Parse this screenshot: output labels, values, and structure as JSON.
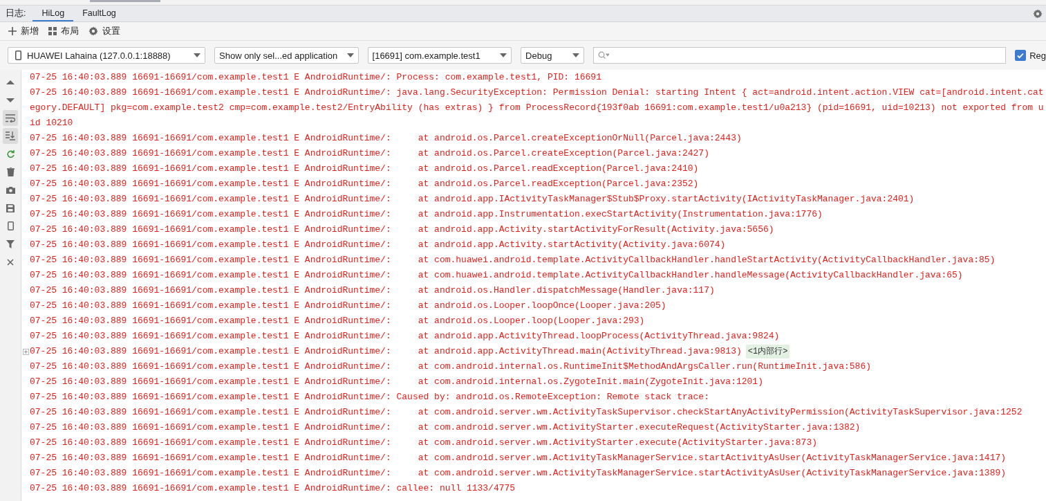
{
  "tabs_label": "日志:",
  "tabs": [
    {
      "label": "HiLog",
      "selected": true
    },
    {
      "label": "FaultLog",
      "selected": false
    }
  ],
  "toolbar": [
    {
      "kind": "add",
      "label": "新增"
    },
    {
      "kind": "layout",
      "label": "布局"
    },
    {
      "kind": "settings",
      "label": "设置"
    }
  ],
  "filters": {
    "device": {
      "kind": "device",
      "value": "HUAWEI Lahaina (127.0.0.1:18888)"
    },
    "dropdowns": [
      {
        "value": "Show only sel...ed application"
      },
      {
        "value": "[16691] com.example.test1"
      },
      {
        "value": "Debug"
      }
    ],
    "regex": {
      "label": "Reg",
      "checked": true
    }
  },
  "side_tools": [
    {
      "kind": "up",
      "selected": false
    },
    {
      "kind": "down",
      "selected": false
    },
    {
      "kind": "wrap",
      "selected": true
    },
    {
      "kind": "scroll-end",
      "selected": true
    },
    {
      "kind": "restart",
      "selected": false
    },
    {
      "kind": "delete",
      "selected": false
    },
    {
      "kind": "camera",
      "selected": false
    },
    {
      "kind": "save",
      "selected": false
    },
    {
      "kind": "device",
      "selected": false
    },
    {
      "kind": "filter",
      "selected": false
    },
    {
      "kind": "close",
      "selected": false
    }
  ],
  "log": [
    {
      "kind": "error",
      "text": "07-25 16:40:03.889 16691-16691/com.example.test1 E AndroidRuntime/: Process: com.example.test1, PID: 16691"
    },
    {
      "kind": "error",
      "text": "07-25 16:40:03.889 16691-16691/com.example.test1 E AndroidRuntime/: java.lang.SecurityException: Permission Denial: starting Intent { act=android.intent.action.VIEW cat=[android.intent.category.DEFAULT] pkg=com.example.test2 cmp=com.example.test2/EntryAbility (has extras) } from ProcessRecord{193f0ab 16691:com.example.test1/u0a213} (pid=16691, uid=10213) not exported from uid 10210"
    },
    {
      "kind": "error",
      "text": "07-25 16:40:03.889 16691-16691/com.example.test1 E AndroidRuntime/:     at android.os.Parcel.createExceptionOrNull(Parcel.java:2443)"
    },
    {
      "kind": "error",
      "text": "07-25 16:40:03.889 16691-16691/com.example.test1 E AndroidRuntime/:     at android.os.Parcel.createException(Parcel.java:2427)"
    },
    {
      "kind": "error",
      "text": "07-25 16:40:03.889 16691-16691/com.example.test1 E AndroidRuntime/:     at android.os.Parcel.readException(Parcel.java:2410)"
    },
    {
      "kind": "error",
      "text": "07-25 16:40:03.889 16691-16691/com.example.test1 E AndroidRuntime/:     at android.os.Parcel.readException(Parcel.java:2352)"
    },
    {
      "kind": "error",
      "text": "07-25 16:40:03.889 16691-16691/com.example.test1 E AndroidRuntime/:     at android.app.IActivityTaskManager$Stub$Proxy.startActivity(IActivityTaskManager.java:2401)"
    },
    {
      "kind": "error",
      "text": "07-25 16:40:03.889 16691-16691/com.example.test1 E AndroidRuntime/:     at android.app.Instrumentation.execStartActivity(Instrumentation.java:1776)"
    },
    {
      "kind": "error",
      "text": "07-25 16:40:03.889 16691-16691/com.example.test1 E AndroidRuntime/:     at android.app.Activity.startActivityForResult(Activity.java:5656)"
    },
    {
      "kind": "error",
      "text": "07-25 16:40:03.889 16691-16691/com.example.test1 E AndroidRuntime/:     at android.app.Activity.startActivity(Activity.java:6074)"
    },
    {
      "kind": "error",
      "text": "07-25 16:40:03.889 16691-16691/com.example.test1 E AndroidRuntime/:     at com.huawei.android.template.ActivityCallbackHandler.handleStartActivity(ActivityCallbackHandler.java:85)"
    },
    {
      "kind": "error",
      "text": "07-25 16:40:03.889 16691-16691/com.example.test1 E AndroidRuntime/:     at com.huawei.android.template.ActivityCallbackHandler.handleMessage(ActivityCallbackHandler.java:65)"
    },
    {
      "kind": "error",
      "text": "07-25 16:40:03.889 16691-16691/com.example.test1 E AndroidRuntime/:     at android.os.Handler.dispatchMessage(Handler.java:117)"
    },
    {
      "kind": "error",
      "text": "07-25 16:40:03.889 16691-16691/com.example.test1 E AndroidRuntime/:     at android.os.Looper.loopOnce(Looper.java:205)"
    },
    {
      "kind": "error",
      "text": "07-25 16:40:03.889 16691-16691/com.example.test1 E AndroidRuntime/:     at android.os.Looper.loop(Looper.java:293)"
    },
    {
      "kind": "error",
      "text": "07-25 16:40:03.889 16691-16691/com.example.test1 E AndroidRuntime/:     at android.app.ActivityThread.loopProcess(ActivityThread.java:9824)"
    },
    {
      "kind": "error",
      "text": "07-25 16:40:03.889 16691-16691/com.example.test1 E AndroidRuntime/:     at android.app.ActivityThread.main(ActivityThread.java:9813)",
      "folded": "<1内部行>"
    },
    {
      "kind": "error",
      "text": "07-25 16:40:03.889 16691-16691/com.example.test1 E AndroidRuntime/:     at com.android.internal.os.RuntimeInit$MethodAndArgsCaller.run(RuntimeInit.java:586)"
    },
    {
      "kind": "error",
      "text": "07-25 16:40:03.889 16691-16691/com.example.test1 E AndroidRuntime/:     at com.android.internal.os.ZygoteInit.main(ZygoteInit.java:1201)"
    },
    {
      "kind": "error",
      "text": "07-25 16:40:03.889 16691-16691/com.example.test1 E AndroidRuntime/: Caused by: android.os.RemoteException: Remote stack trace:"
    },
    {
      "kind": "error",
      "text": "07-25 16:40:03.889 16691-16691/com.example.test1 E AndroidRuntime/:     at com.android.server.wm.ActivityTaskSupervisor.checkStartAnyActivityPermission(ActivityTaskSupervisor.java:1252"
    },
    {
      "kind": "error",
      "text": "07-25 16:40:03.889 16691-16691/com.example.test1 E AndroidRuntime/:     at com.android.server.wm.ActivityStarter.executeRequest(ActivityStarter.java:1382)"
    },
    {
      "kind": "error",
      "text": "07-25 16:40:03.889 16691-16691/com.example.test1 E AndroidRuntime/:     at com.android.server.wm.ActivityStarter.execute(ActivityStarter.java:873)"
    },
    {
      "kind": "error",
      "text": "07-25 16:40:03.889 16691-16691/com.example.test1 E AndroidRuntime/:     at com.android.server.wm.ActivityTaskManagerService.startActivityAsUser(ActivityTaskManagerService.java:1417)"
    },
    {
      "kind": "error",
      "text": "07-25 16:40:03.889 16691-16691/com.example.test1 E AndroidRuntime/:     at com.android.server.wm.ActivityTaskManagerService.startActivityAsUser(ActivityTaskManagerService.java:1389)"
    },
    {
      "kind": "error",
      "text": "07-25 16:40:03.889 16691-16691/com.example.test1 E AndroidRuntime/: callee: null 1133/4775"
    }
  ]
}
